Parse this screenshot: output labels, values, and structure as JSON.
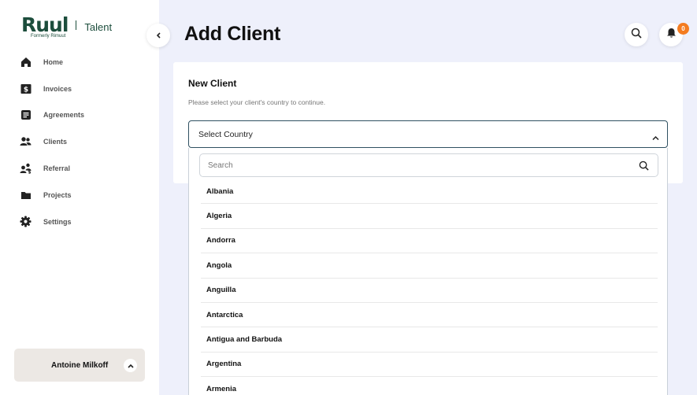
{
  "brand": {
    "logo_text": "Ruul",
    "logo_subtitle": "Formerly Rimuut",
    "product": "Talent"
  },
  "sidebar": {
    "items": [
      {
        "label": "Home",
        "icon": "home-icon"
      },
      {
        "label": "Invoices",
        "icon": "invoice-icon"
      },
      {
        "label": "Agreements",
        "icon": "agreement-icon"
      },
      {
        "label": "Clients",
        "icon": "clients-icon"
      },
      {
        "label": "Referral",
        "icon": "referral-icon"
      },
      {
        "label": "Projects",
        "icon": "folder-icon"
      },
      {
        "label": "Settings",
        "icon": "gear-icon"
      }
    ],
    "user": {
      "name": "Antoine Milkoff"
    }
  },
  "header": {
    "title": "Add Client",
    "notification_count": "0"
  },
  "form": {
    "title": "New Client",
    "hint": "Please select your client's country to continue.",
    "country_select": {
      "value": "Select Country",
      "search_placeholder": "Search",
      "options": [
        "Albania",
        "Algeria",
        "Andorra",
        "Angola",
        "Anguilla",
        "Antarctica",
        "Antigua and Barbuda",
        "Argentina",
        "Armenia"
      ]
    }
  },
  "colors": {
    "brand": "#1c4d3c",
    "badge": "#f47c20",
    "page_bg": "#eef0fb",
    "select_border": "#2f5061"
  }
}
